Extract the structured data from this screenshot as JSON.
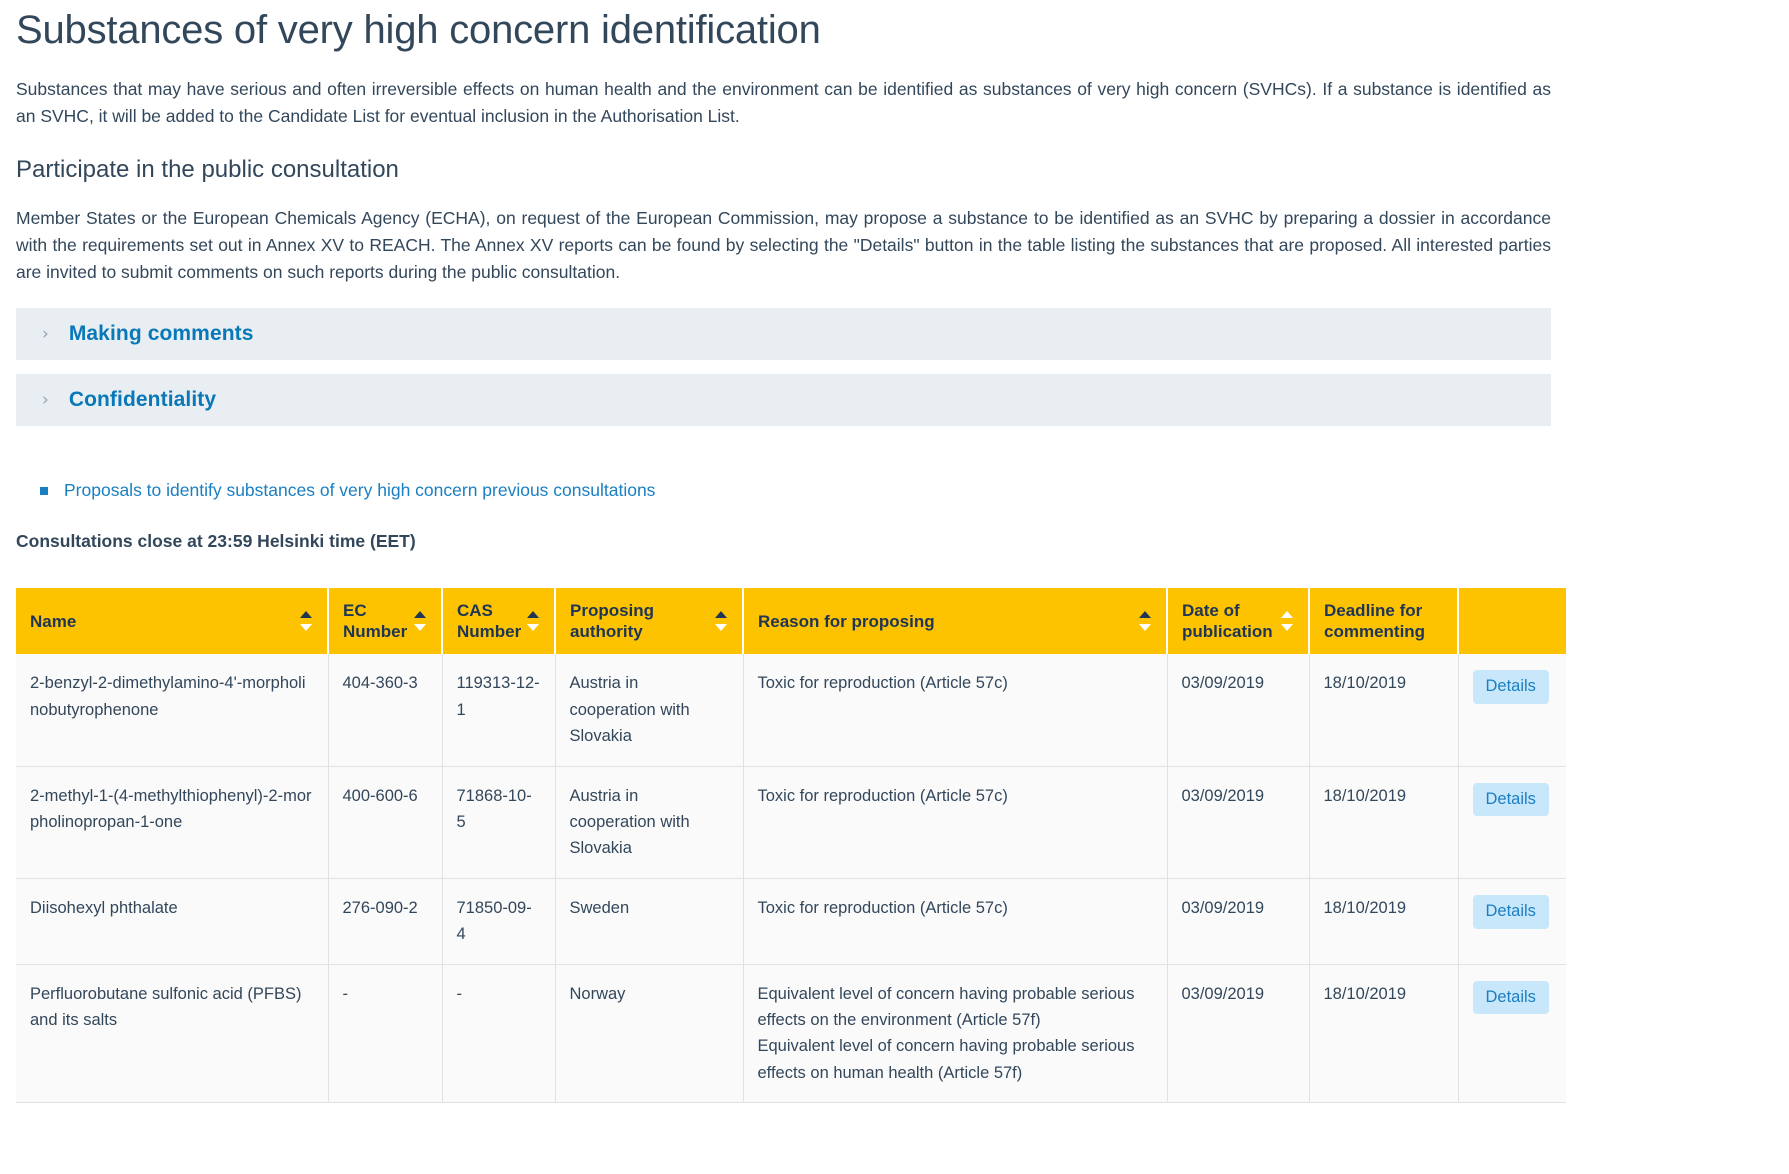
{
  "page_title": "Substances of very high concern identification",
  "intro_paragraph": "Substances that may have serious and often irreversible effects on human health and the environment can be identified as substances of very high concern (SVHCs). If a substance is identified as an SVHC, it will be added to the Candidate List for eventual inclusion in the Authorisation List.",
  "section_heading": "Participate in the public consultation",
  "section_paragraph": "Member States or the European Chemicals Agency (ECHA), on request of the European Commission, may propose a substance to be identified as an SVHC by preparing a dossier in accordance with the requirements set out in Annex XV to REACH. The Annex XV reports can be found by selecting the \"Details\" button in the table listing the substances that are proposed. All interested parties are invited to submit comments on such reports during the public consultation.",
  "accordions": [
    {
      "label": "Making comments",
      "icon": "chevron-right-icon"
    },
    {
      "label": "Confidentiality",
      "icon": "chevron-right-icon"
    }
  ],
  "related_link": "Proposals to identify substances of very high concern previous consultations",
  "close_note": "Consultations close at 23:59 Helsinki time (EET)",
  "table": {
    "columns": [
      {
        "label": "Name",
        "sort": "asc-dark"
      },
      {
        "label": "EC Number",
        "sort": "asc-dark"
      },
      {
        "label": "CAS Number",
        "sort": "asc-dark"
      },
      {
        "label": "Proposing authority",
        "sort": "asc-dark"
      },
      {
        "label": "Reason for proposing",
        "sort": "asc-dark"
      },
      {
        "label": "Date of publication",
        "sort": "white"
      },
      {
        "label": "Deadline for commenting",
        "sort": "none"
      },
      {
        "label": "",
        "sort": "none"
      }
    ],
    "details_label": "Details",
    "rows": [
      {
        "name": "2-benzyl-2-dimethylamino-4'-morpholinobutyrophenone",
        "ec_number": "404-360-3",
        "cas_number": "119313-12-1",
        "proposing_authority": "Austria in cooperation with Slovakia",
        "reasons": [
          "Toxic for reproduction (Article 57c)"
        ],
        "date_of_publication": "03/09/2019",
        "deadline_for_commenting": "18/10/2019"
      },
      {
        "name": "2-methyl-1-(4-methylthiophenyl)-2-morpholinopropan-1-one",
        "ec_number": "400-600-6",
        "cas_number": "71868-10-5",
        "proposing_authority": "Austria in cooperation with Slovakia",
        "reasons": [
          "Toxic for reproduction (Article 57c)"
        ],
        "date_of_publication": "03/09/2019",
        "deadline_for_commenting": "18/10/2019"
      },
      {
        "name": "Diisohexyl phthalate",
        "ec_number": "276-090-2",
        "cas_number": "71850-09-4",
        "proposing_authority": "Sweden",
        "reasons": [
          "Toxic for reproduction (Article 57c)"
        ],
        "date_of_publication": "03/09/2019",
        "deadline_for_commenting": "18/10/2019"
      },
      {
        "name": "Perfluorobutane sulfonic acid (PFBS) and its salts",
        "ec_number": "-",
        "cas_number": "-",
        "proposing_authority": "Norway",
        "reasons": [
          "Equivalent level of concern having probable serious effects on the environment (Article 57f)",
          "Equivalent level of concern having probable serious effects on human health (Article 57f)"
        ],
        "date_of_publication": "03/09/2019",
        "deadline_for_commenting": "18/10/2019"
      }
    ]
  },
  "colors": {
    "header_yellow": "#fdc300",
    "link_blue": "#1a7fc1",
    "accordion_bg": "#e9eef2",
    "details_bg": "#c9e7fa",
    "text": "#33475b"
  }
}
